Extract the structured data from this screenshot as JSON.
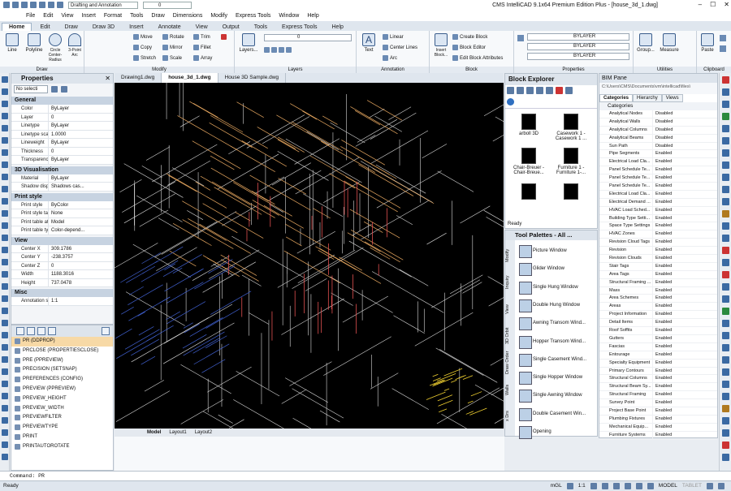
{
  "titlebar": {
    "workspace": "Drafting and Annotation",
    "layer_value": "0",
    "title": "CMS IntelliCAD 9.1x64 Premium Edition Plus - [house_3d_1.dwg]",
    "min": "–",
    "max": "☐",
    "close": "✕"
  },
  "menu": [
    "File",
    "Edit",
    "View",
    "Insert",
    "Format",
    "Tools",
    "Draw",
    "Dimensions",
    "Modify",
    "Express Tools",
    "Window",
    "Help"
  ],
  "ribbon_tabs": [
    "Home",
    "Edit",
    "Draw",
    "Draw 3D",
    "Insert",
    "Annotate",
    "View",
    "Output",
    "Tools",
    "Express Tools",
    "Help"
  ],
  "ribbon": {
    "draw": {
      "label": "Draw",
      "line": "Line",
      "polyline": "Polyline",
      "circle": "Circle Center-Radius",
      "arc": "3-Point Arc"
    },
    "modify": {
      "label": "Modify",
      "move": "Move",
      "rotate": "Rotate",
      "trim": "Trim",
      "copy": "Copy",
      "mirror": "Mirror",
      "fillet": "Fillet",
      "stretch": "Stretch",
      "scale": "Scale",
      "array": "Array"
    },
    "layers": {
      "label": "Layers",
      "layers_btn": "Layers...",
      "value": "0"
    },
    "annotation": {
      "label": "Annotation",
      "text": "Text",
      "linear": "Linear",
      "center_lines": "Center Lines",
      "arc": "Arc"
    },
    "block": {
      "label": "Block",
      "insert": "Insert Block...",
      "create": "Create Block",
      "editor": "Block Editor",
      "edit_attr": "Edit Block Attributes"
    },
    "properties": {
      "label": "Properties",
      "row1": "BYLAYER",
      "row2": "BYLAYER",
      "row3": "BYLAYER"
    },
    "utilities": {
      "label": "Utilities",
      "group": "Group...",
      "measure": "Measure"
    },
    "clipboard": {
      "label": "Clipboard",
      "paste": "Paste"
    }
  },
  "properties": {
    "title": "Properties",
    "selection": "No selecti",
    "sections": {
      "general": "General",
      "visual": "3D Visualisation",
      "print": "Print style",
      "view": "View",
      "misc": "Misc"
    },
    "general_rows": [
      {
        "k": "Color",
        "v": "ByLayer"
      },
      {
        "k": "Layer",
        "v": "0"
      },
      {
        "k": "Linetype",
        "v": "ByLayer"
      },
      {
        "k": "Linetype scale",
        "v": "1.0000"
      },
      {
        "k": "Lineweight",
        "v": "ByLayer"
      },
      {
        "k": "Thickness",
        "v": "0"
      },
      {
        "k": "Transparency",
        "v": "ByLayer"
      }
    ],
    "visual_rows": [
      {
        "k": "Material",
        "v": "ByLayer"
      },
      {
        "k": "Shadow displ...",
        "v": "Shadows cas..."
      }
    ],
    "print_rows": [
      {
        "k": "Print style",
        "v": "ByColor"
      },
      {
        "k": "Print style table",
        "v": "None"
      },
      {
        "k": "Print table att...",
        "v": "Model"
      },
      {
        "k": "Print table type",
        "v": "Color-depend..."
      }
    ],
    "view_rows": [
      {
        "k": "Center X",
        "v": "309.1786"
      },
      {
        "k": "Center Y",
        "v": "-238.3757"
      },
      {
        "k": "Center Z",
        "v": "0"
      },
      {
        "k": "Width",
        "v": "1188.3016"
      },
      {
        "k": "Height",
        "v": "737.0478"
      }
    ],
    "misc_rows": [
      {
        "k": "Annotation s...",
        "v": "1:1"
      }
    ]
  },
  "commands": [
    "PR (DDPROP)",
    "PRCLOSE (PROPERTIESCLOSE)",
    "PRE (PPREVIEW)",
    "PRECISION (SETSNAP)",
    "PREFERENCES (CONFIG)",
    "PREVIEW (PPREVIEW)",
    "PREVIEW_HEIGHT",
    "PREVIEW_WIDTH",
    "PREVIEWFILTER",
    "PREVIEWTYPE",
    "PRINT",
    "PRINTAUTOROTATE"
  ],
  "doc_tabs": [
    "Drawing1.dwg",
    "house_3d_1.dwg",
    "House 3D Sample.dwg"
  ],
  "layout_tabs": [
    "Model",
    "Layout1",
    "Layout2"
  ],
  "block_explorer": {
    "title": "Block Explorer",
    "items": [
      {
        "name": "arboll 3D"
      },
      {
        "name": "Casework 1 - Casework 1 ..."
      },
      {
        "name": "Chair-Breuer - Chair-Breue..."
      },
      {
        "name": "Furniture 1 - Furniture 1-..."
      }
    ],
    "status": "Ready"
  },
  "tool_palettes": {
    "title": "Tool Palettes - All ...",
    "side_tabs": [
      "Modify",
      "Inquiry",
      "View",
      "3D Orbit",
      "Draw Order",
      "Walls",
      "x Drs"
    ],
    "items": [
      "Picture Window",
      "Glider Window",
      "Single Hung Window",
      "Double Hung Window",
      "Awning Transom Wind...",
      "Hopper Transom Wind...",
      "Single Casement Wind...",
      "Single Hopper Window",
      "Single Awning Window",
      "Double Casement Win...",
      "Opening"
    ]
  },
  "bim": {
    "title": "BIM Pane",
    "path": "C:\\Users\\CMS\\Documents\\vm\\intellicad\\files\\",
    "tabs": [
      "Categories",
      "Hierarchy",
      "Views"
    ],
    "category_header": "Categories",
    "rows": [
      {
        "n": "Analytical Nodes",
        "s": "Disabled"
      },
      {
        "n": "Analytical Walls",
        "s": "Disabled"
      },
      {
        "n": "Analytical Columns",
        "s": "Disabled"
      },
      {
        "n": "Analytical Beams",
        "s": "Disabled"
      },
      {
        "n": "Sun Path",
        "s": "Disabled"
      },
      {
        "n": "Pipe Segments",
        "s": "Enabled"
      },
      {
        "n": "Electrical Load Cla...",
        "s": "Enabled"
      },
      {
        "n": "Panel Schedule Te...",
        "s": "Enabled"
      },
      {
        "n": "Panel Schedule Te...",
        "s": "Enabled"
      },
      {
        "n": "Panel Schedule Te...",
        "s": "Enabled"
      },
      {
        "n": "Electrical Load Cla...",
        "s": "Enabled"
      },
      {
        "n": "Electrical Demand ...",
        "s": "Enabled"
      },
      {
        "n": "HVAC Load Sched...",
        "s": "Enabled"
      },
      {
        "n": "Building Type Setti...",
        "s": "Enabled"
      },
      {
        "n": "Space Type Settings",
        "s": "Enabled"
      },
      {
        "n": "HVAC Zones",
        "s": "Enabled"
      },
      {
        "n": "Revision Cloud Tags",
        "s": "Enabled"
      },
      {
        "n": "Revision",
        "s": "Enabled"
      },
      {
        "n": "Revision Clouds",
        "s": "Enabled"
      },
      {
        "n": "Stair Tags",
        "s": "Enabled"
      },
      {
        "n": "Area Tags",
        "s": "Enabled"
      },
      {
        "n": "Structural Framing ...",
        "s": "Enabled"
      },
      {
        "n": "Mass",
        "s": "Enabled"
      },
      {
        "n": "Area Schemes",
        "s": "Enabled"
      },
      {
        "n": "Areas",
        "s": "Enabled"
      },
      {
        "n": "Project Information",
        "s": "Enabled"
      },
      {
        "n": "Detail Items",
        "s": "Enabled"
      },
      {
        "n": "Roof Soffits",
        "s": "Enabled"
      },
      {
        "n": "Gutters",
        "s": "Enabled"
      },
      {
        "n": "Fascias",
        "s": "Enabled"
      },
      {
        "n": "Entourage",
        "s": "Enabled"
      },
      {
        "n": "Specialty Equipment",
        "s": "Enabled"
      },
      {
        "n": "Primary Contours",
        "s": "Enabled"
      },
      {
        "n": "Structural Columns",
        "s": "Enabled"
      },
      {
        "n": "Structural Beam Sy...",
        "s": "Enabled"
      },
      {
        "n": "Structural Framing",
        "s": "Enabled"
      },
      {
        "n": "Survey Point",
        "s": "Enabled"
      },
      {
        "n": "Project Base Point",
        "s": "Enabled"
      },
      {
        "n": "Plumbing Fixtures",
        "s": "Enabled"
      },
      {
        "n": "Mechanical Equip...",
        "s": "Enabled"
      },
      {
        "n": "Furniture Systems",
        "s": "Enabled"
      }
    ]
  },
  "command_line": "Command: PR",
  "status": {
    "left": "Ready",
    "units": "mGL",
    "scale": "1:1",
    "model": "MODEL",
    "tablet": "TABLET"
  }
}
